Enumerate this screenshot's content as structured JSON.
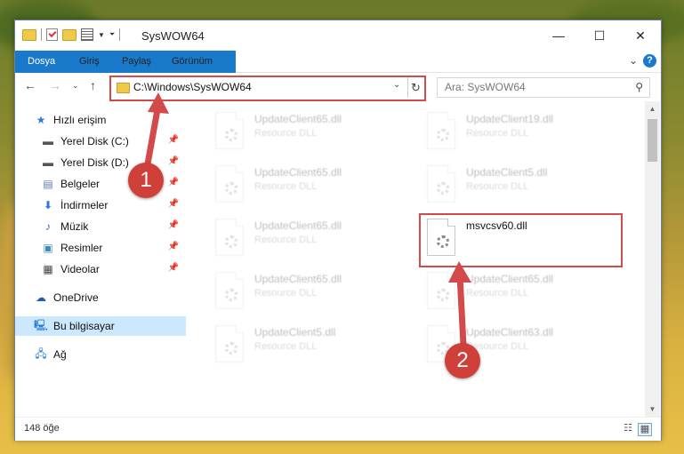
{
  "window": {
    "title": "SysWOW64",
    "controls": {
      "minimize": "—",
      "maximize": "☐",
      "close": "✕"
    }
  },
  "ribbon": {
    "tabs": [
      "Dosya",
      "Giriş",
      "Paylaş",
      "Görünüm"
    ],
    "help": "?",
    "expand": "⌄"
  },
  "address": {
    "path": "C:\\Windows\\SysWOW64",
    "search_placeholder": "Ara: SysWOW64"
  },
  "nav": {
    "quick_access": "Hızlı erişim",
    "items": [
      {
        "label": "Yerel Disk (C:)",
        "icon": "drive-icon",
        "pinned": true
      },
      {
        "label": "Yerel Disk (D:)",
        "icon": "drive-icon",
        "pinned": true
      },
      {
        "label": "Belgeler",
        "icon": "documents-icon",
        "pinned": true
      },
      {
        "label": "İndirmeler",
        "icon": "download-icon",
        "pinned": true
      },
      {
        "label": "Müzik",
        "icon": "music-icon",
        "pinned": true
      },
      {
        "label": "Resimler",
        "icon": "pictures-icon",
        "pinned": true
      },
      {
        "label": "Videolar",
        "icon": "videos-icon",
        "pinned": true
      }
    ],
    "onedrive": "OneDrive",
    "this_pc": "Bu bilgisayar",
    "network": "Ağ"
  },
  "files": [
    {
      "name": "UpdateClient65.dll",
      "desc": "Resource DLL"
    },
    {
      "name": "UpdateClient19.dll",
      "desc": "Resource DLL"
    },
    {
      "name": "UpdateClient65.dll",
      "desc": "Resource DLL"
    },
    {
      "name": "UpdateClient5.dll",
      "desc": "Resource DLL"
    },
    {
      "name": "UpdateClient65.dll",
      "desc": "Resource DLL"
    },
    {
      "name": "msvcsv60.dll",
      "desc": ""
    },
    {
      "name": "UpdateClient65.dll",
      "desc": "Resource DLL"
    },
    {
      "name": "UpdateClient65.dll",
      "desc": "Resource DLL"
    },
    {
      "name": "UpdateClient5.dll",
      "desc": "Resource DLL"
    },
    {
      "name": "UpdateClient63.dll",
      "desc": "Resource DLL"
    }
  ],
  "status": {
    "count": "148 öğe"
  },
  "annotations": {
    "step1": "1",
    "step2": "2"
  },
  "colors": {
    "accent": "#1979ca",
    "highlight": "#d34a4a",
    "selection": "#cce8ff"
  }
}
